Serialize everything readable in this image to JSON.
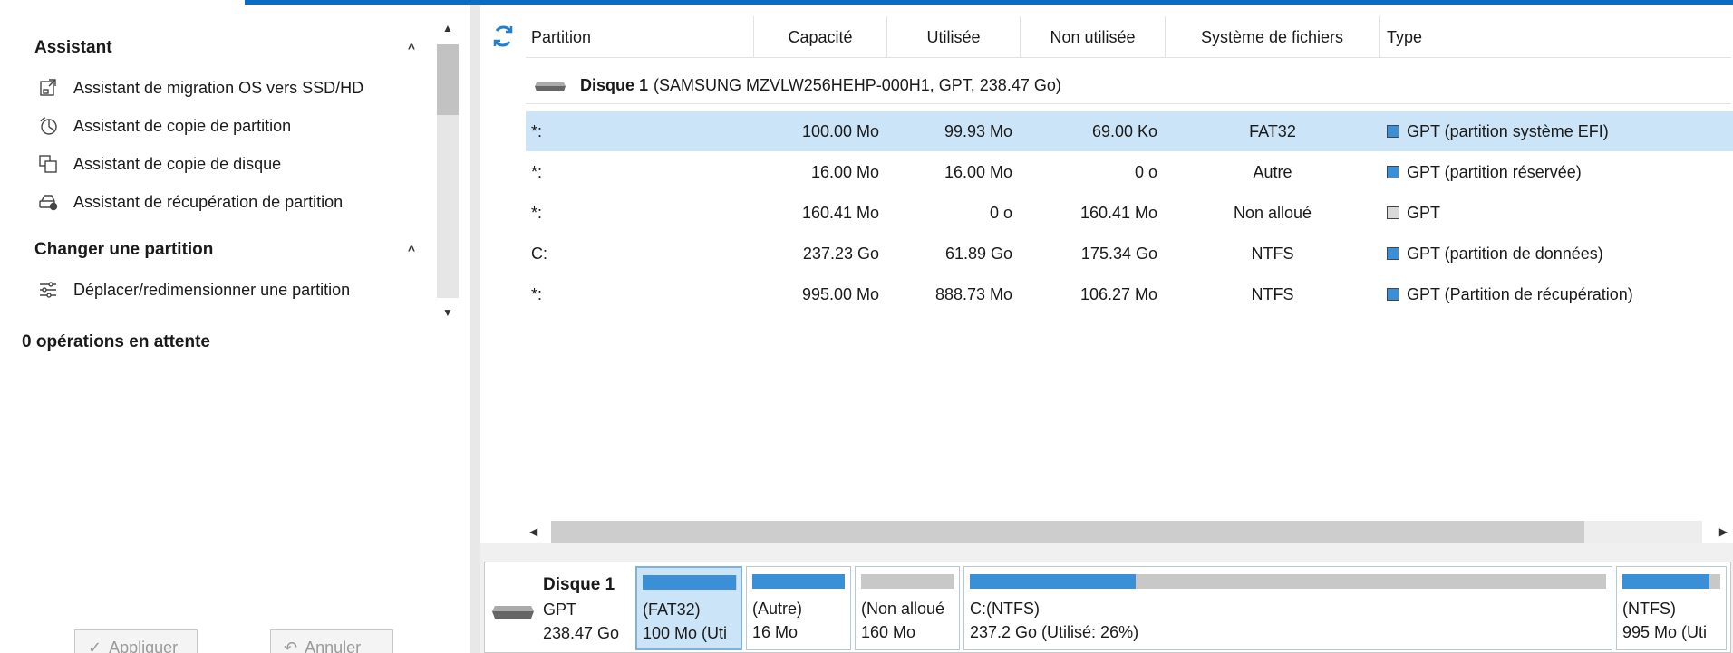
{
  "left": {
    "sections": [
      {
        "title": "Assistant",
        "items": [
          {
            "icon": "migrate-os-icon",
            "label": "Assistant de migration OS vers SSD/HD"
          },
          {
            "icon": "copy-partition-icon",
            "label": "Assistant de copie de partition"
          },
          {
            "icon": "copy-disk-icon",
            "label": "Assistant de copie de disque"
          },
          {
            "icon": "recover-partition-icon",
            "label": "Assistant de récupération de partition"
          }
        ]
      },
      {
        "title": "Changer une partition",
        "items": [
          {
            "icon": "sliders-icon",
            "label": "Déplacer/redimensionner une partition"
          }
        ]
      }
    ],
    "pending": "0 opérations en attente",
    "apply_label": "Appliquer",
    "cancel_label": "Annuler"
  },
  "table": {
    "columns": [
      "Partition",
      "Capacité",
      "Utilisée",
      "Non utilisée",
      "Système de fichiers",
      "Type"
    ],
    "disk": {
      "name": "Disque 1",
      "detail": "(SAMSUNG MZVLW256HEHP-000H1, GPT, 238.47 Go)"
    },
    "rows": [
      {
        "partition": "*:",
        "capacity": "100.00 Mo",
        "used": "99.93 Mo",
        "unused": "69.00 Ko",
        "fs": "FAT32",
        "type": "GPT (partition système EFI)",
        "color": "#3a8fd6"
      },
      {
        "partition": "*:",
        "capacity": "16.00 Mo",
        "used": "16.00 Mo",
        "unused": "0 o",
        "fs": "Autre",
        "type": "GPT (partition réservée)",
        "color": "#3a8fd6"
      },
      {
        "partition": "*:",
        "capacity": "160.41 Mo",
        "used": "0 o",
        "unused": "160.41 Mo",
        "fs": "Non alloué",
        "type": "GPT",
        "color": "#d9d9d9"
      },
      {
        "partition": "C:",
        "capacity": "237.23 Go",
        "used": "61.89 Go",
        "unused": "175.34 Go",
        "fs": "NTFS",
        "type": "GPT (partition de données)",
        "color": "#3a8fd6"
      },
      {
        "partition": "*:",
        "capacity": "995.00 Mo",
        "used": "888.73 Mo",
        "unused": "106.27 Mo",
        "fs": "NTFS",
        "type": "GPT (Partition de récupération)",
        "color": "#3a8fd6"
      }
    ]
  },
  "map": {
    "disk_name": "Disque 1",
    "disk_type": "GPT",
    "disk_size": "238.47 Go",
    "blocks": [
      {
        "l1": "(FAT32)",
        "l2": "100 Mo (Uti",
        "fill": 0.99
      },
      {
        "l1": "(Autre)",
        "l2": "16 Mo",
        "fill": 1.0
      },
      {
        "l1": "(Non alloué",
        "l2": "160 Mo",
        "fill": 0
      },
      {
        "l1": "C:(NTFS)",
        "l2": "237.2 Go (Utilisé: 26%)",
        "fill": 0.26
      },
      {
        "l1": "(NTFS)",
        "l2": "995 Mo (Uti",
        "fill": 0.89
      }
    ]
  }
}
